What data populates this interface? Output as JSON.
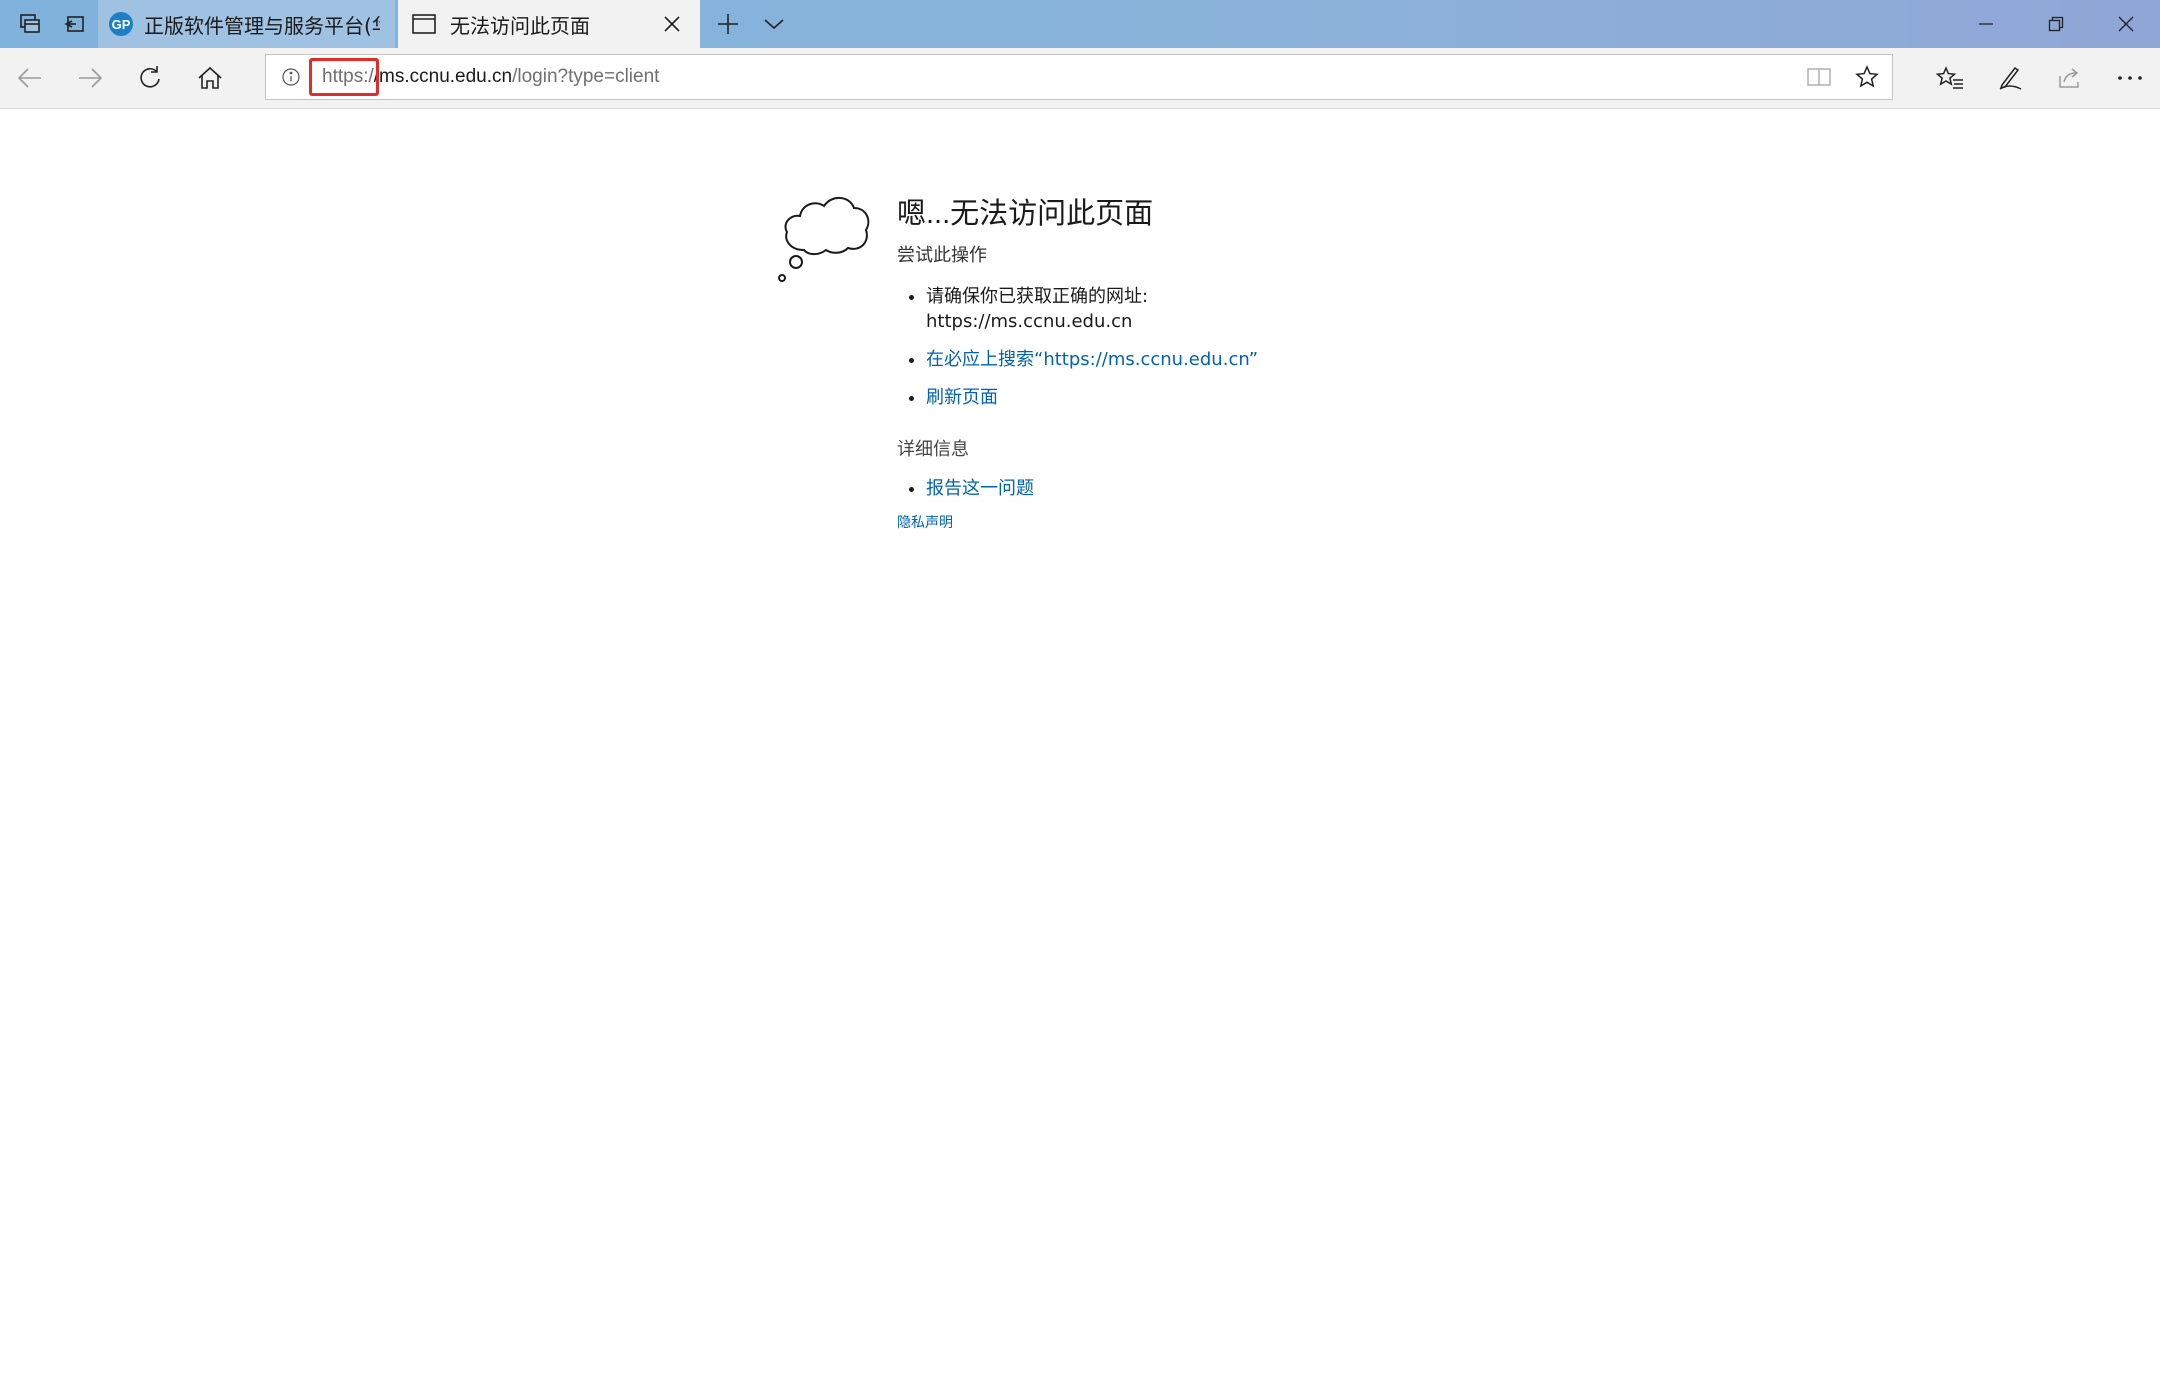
{
  "window": {
    "tabs": [
      {
        "title": "正版软件管理与服务平台(华",
        "active": false,
        "icon": "gp-logo-icon"
      },
      {
        "title": "无法访问此页面",
        "active": true,
        "icon": "page-icon"
      }
    ],
    "tab_close": "×"
  },
  "address_bar": {
    "scheme": "https:/",
    "host": "/ms.ccnu.edu.cn",
    "path": "/login?type=client",
    "highlight_color": "#e52a2a"
  },
  "error_page": {
    "title": "嗯...无法访问此页面",
    "subtitle": "尝试此操作",
    "suggestions": [
      {
        "line1": "请确保你已获取正确的网址:",
        "line2": "https://ms.ccnu.edu.cn"
      },
      {
        "link": "在必应上搜索“https://ms.ccnu.edu.cn”"
      },
      {
        "link": "刷新页面"
      }
    ],
    "details_heading": "详细信息",
    "details_items": [
      {
        "link": "报告这一问题"
      }
    ],
    "privacy": "隐私声明"
  },
  "colors": {
    "titlebar_start": "#7fb2dc",
    "titlebar_end": "#90a6d6",
    "link": "#0063b1",
    "chrome": "#f2f2f2"
  }
}
